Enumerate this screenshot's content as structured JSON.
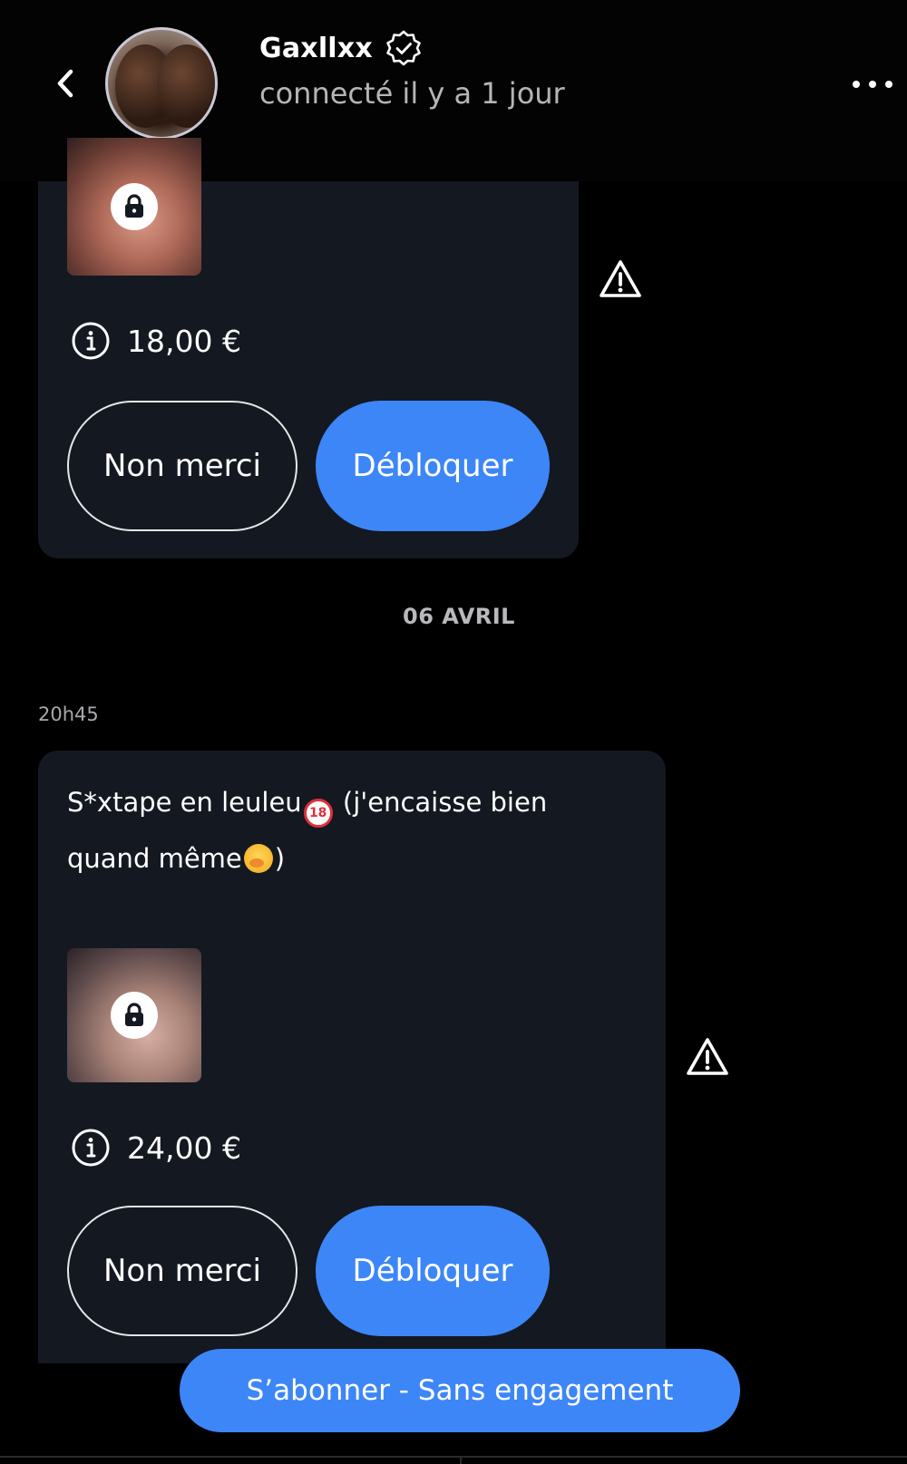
{
  "header": {
    "username": "Gaxllxx",
    "status": "connecté il y a 1 jour"
  },
  "messages": [
    {
      "text_parts": [],
      "price": "18,00 €",
      "decline_label": "Non merci",
      "unlock_label": "Débloquer"
    },
    {
      "timestamp": "20h45",
      "text_parts": [
        "S*xtape en leuleu",
        "(j'encaisse bien quand même",
        ")"
      ],
      "price": "24,00 €",
      "decline_label": "Non merci",
      "unlock_label": "Débloquer"
    }
  ],
  "date_separator": "06 AVRIL",
  "subscribe_label": "S’abonner - Sans engagement",
  "colors": {
    "accent": "#3d86f7",
    "card_bg": "#141821",
    "background": "#000000"
  },
  "icons": [
    "back-chevron-icon",
    "verified-badge-icon",
    "more-dots-icon",
    "lock-icon",
    "info-icon",
    "warning-icon",
    "no-under-18-emoji",
    "shushing-face-emoji"
  ]
}
